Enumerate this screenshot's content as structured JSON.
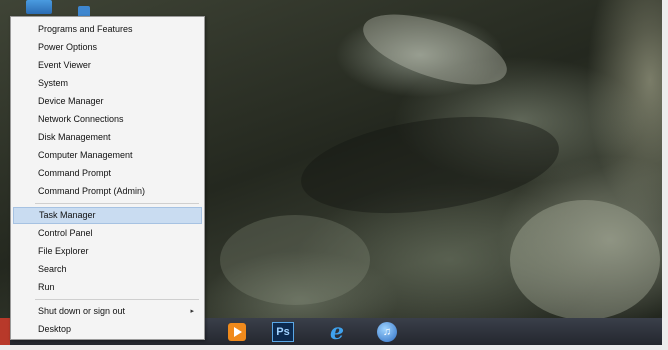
{
  "menu": {
    "items": [
      {
        "label": "Programs and Features"
      },
      {
        "label": "Power Options"
      },
      {
        "label": "Event Viewer"
      },
      {
        "label": "System"
      },
      {
        "label": "Device Manager"
      },
      {
        "label": "Network Connections"
      },
      {
        "label": "Disk Management"
      },
      {
        "label": "Computer Management"
      },
      {
        "label": "Command Prompt"
      },
      {
        "label": "Command Prompt (Admin)"
      },
      {
        "label": "Task Manager",
        "selected": true
      },
      {
        "label": "Control Panel"
      },
      {
        "label": "File Explorer"
      },
      {
        "label": "Search"
      },
      {
        "label": "Run"
      },
      {
        "label": "Shut down or sign out",
        "submenu": true,
        "arrow": "▸"
      },
      {
        "label": "Desktop"
      }
    ]
  },
  "taskbar": {
    "apps": [
      {
        "icon": "media-player-icon"
      },
      {
        "icon": "photoshop-icon",
        "text": "Ps"
      },
      {
        "icon": "internet-explorer-icon",
        "text": "e"
      },
      {
        "icon": "itunes-icon",
        "text": "♫"
      }
    ]
  },
  "colors": {
    "menu_bg": "#f4f4f4",
    "selection": "#c9dcf1",
    "taskbar": "#2d3038"
  }
}
